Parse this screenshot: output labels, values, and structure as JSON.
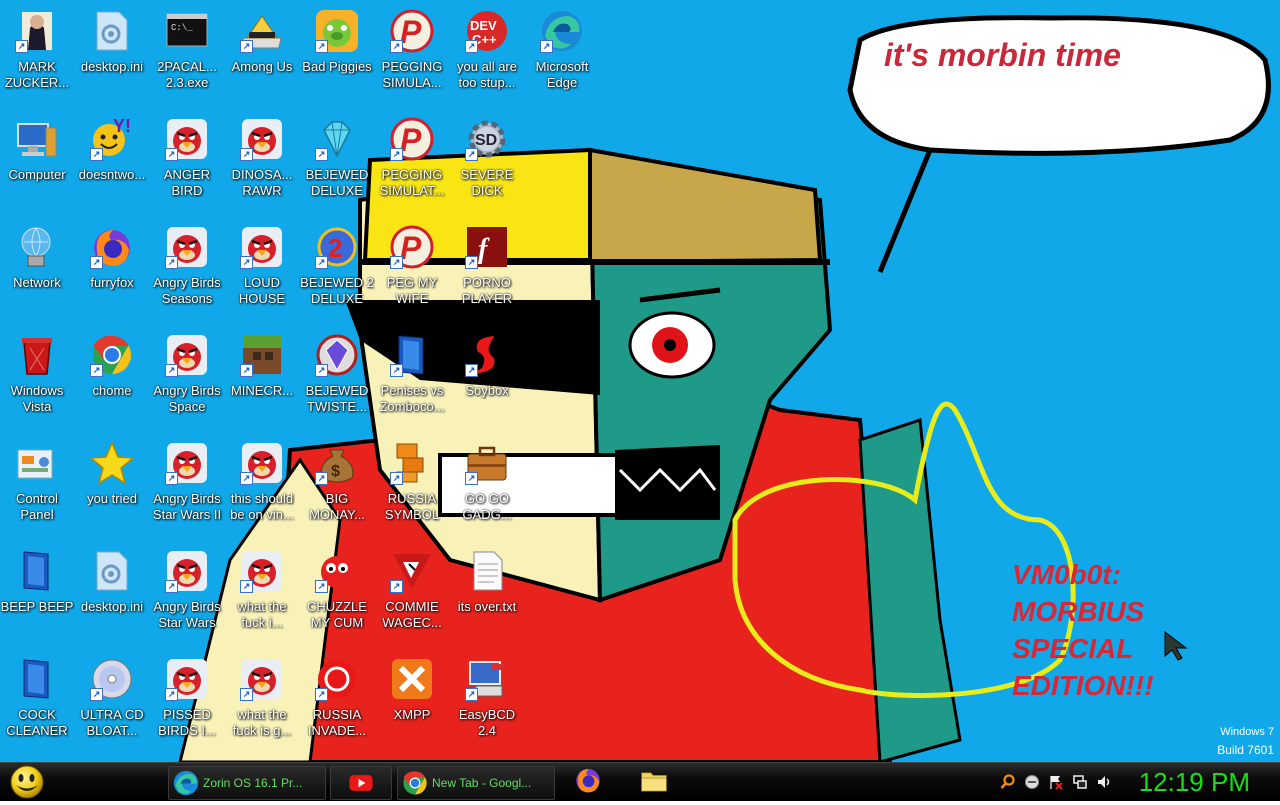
{
  "wallpaper": {
    "speech_bubble_text": "it's morbin time",
    "tag_line_1": "VM0b0t:",
    "tag_line_2": "MORBIUS",
    "tag_line_3": "SPECIAL",
    "tag_line_4": "EDITION!!!",
    "background_color": "#10a8e8"
  },
  "desktop_icons": [
    {
      "label": "MARK ZUCKER...",
      "icon": "person-icon",
      "shortcut": true
    },
    {
      "label": "desktop.ini",
      "icon": "settings-file-icon",
      "shortcut": false
    },
    {
      "label": "2PACAL... 2.3.exe",
      "icon": "console-icon",
      "shortcut": false
    },
    {
      "label": "Among Us",
      "icon": "scanner-icon",
      "shortcut": true
    },
    {
      "label": "Bad Piggies",
      "icon": "green-pig-icon",
      "shortcut": true
    },
    {
      "label": "PEGGING SIMULA...",
      "icon": "p-logo-icon",
      "shortcut": true
    },
    {
      "label": "you all are too stup...",
      "icon": "devcpp-icon",
      "shortcut": true
    },
    {
      "label": "Microsoft Edge",
      "icon": "edge-icon",
      "shortcut": true
    },
    {
      "label": "Computer",
      "icon": "computer-icon",
      "shortcut": false
    },
    {
      "label": "doesntwo...",
      "icon": "yahoo-icon",
      "shortcut": true
    },
    {
      "label": "ANGER BIRD",
      "icon": "angry-bird-icon",
      "shortcut": true
    },
    {
      "label": "DINOSA... RAWR",
      "icon": "angry-bird-icon",
      "shortcut": true
    },
    {
      "label": "BEJEWED DELUXE",
      "icon": "diamond-icon",
      "shortcut": true
    },
    {
      "label": "PEGGING SIMULAT...",
      "icon": "p-logo-icon",
      "shortcut": true
    },
    {
      "label": "SEVERE DICK",
      "icon": "gear-sd-icon",
      "shortcut": true
    },
    {
      "label": "Network",
      "icon": "network-globe-icon",
      "shortcut": false
    },
    {
      "label": "furryfox",
      "icon": "firefox-icon",
      "shortcut": true
    },
    {
      "label": "Angry Birds Seasons",
      "icon": "angry-bird-icon",
      "shortcut": true
    },
    {
      "label": "LOUD HOUSE",
      "icon": "angry-bird-icon",
      "shortcut": true
    },
    {
      "label": "BEJEWED 2 DELUXE",
      "icon": "bejeweled2-icon",
      "shortcut": true
    },
    {
      "label": "PEG MY WIFE",
      "icon": "p-logo-icon",
      "shortcut": true
    },
    {
      "label": "PORNO PLAYER",
      "icon": "flash-icon",
      "shortcut": true
    },
    {
      "label": "Windows Vista",
      "icon": "recycle-bin-icon",
      "shortcut": false
    },
    {
      "label": "chome",
      "icon": "chrome-icon",
      "shortcut": true
    },
    {
      "label": "Angry Birds Space",
      "icon": "angry-bird-icon",
      "shortcut": true
    },
    {
      "label": "MINECR...",
      "icon": "minecraft-icon",
      "shortcut": true
    },
    {
      "label": "BEJEWED TWISTE...",
      "icon": "gem-icon",
      "shortcut": true
    },
    {
      "label": "Penises vs Zomboco...",
      "icon": "blue-box-icon",
      "shortcut": true
    },
    {
      "label": "Soybox",
      "icon": "soybox-icon",
      "shortcut": true
    },
    {
      "label": "Control Panel",
      "icon": "control-panel-icon",
      "shortcut": false
    },
    {
      "label": "you tried",
      "icon": "star-icon",
      "shortcut": false
    },
    {
      "label": "Angry Birds Star Wars II",
      "icon": "angry-bird-icon",
      "shortcut": true
    },
    {
      "label": "this should be on vin...",
      "icon": "angry-bird-icon",
      "shortcut": true
    },
    {
      "label": "BIG MONAY...",
      "icon": "money-bag-icon",
      "shortcut": true
    },
    {
      "label": "RUSSIA SYMBOL",
      "icon": "orange-blocks-icon",
      "shortcut": true
    },
    {
      "label": "GO GO GADG...",
      "icon": "briefcase-icon",
      "shortcut": true
    },
    {
      "label": "BEEP BEEP",
      "icon": "blue-box-icon",
      "shortcut": false
    },
    {
      "label": "desktop.ini",
      "icon": "settings-file-icon",
      "shortcut": false
    },
    {
      "label": "Angry Birds Star Wars",
      "icon": "angry-bird-icon",
      "shortcut": true
    },
    {
      "label": "what the fuck i...",
      "icon": "angry-bird-icon",
      "shortcut": true
    },
    {
      "label": "CHUZZLE MY CUM",
      "icon": "chuzzle-icon",
      "shortcut": true
    },
    {
      "label": "COMMIE WAGEC...",
      "icon": "commie-icon",
      "shortcut": true
    },
    {
      "label": "its over.txt",
      "icon": "text-file-icon",
      "shortcut": false
    },
    {
      "label": "COCK CLEANER",
      "icon": "blue-box-icon",
      "shortcut": false
    },
    {
      "label": "ULTRA CD BLOAT...",
      "icon": "cd-icon",
      "shortcut": true
    },
    {
      "label": "PISSED BIRDS I...",
      "icon": "angry-bird-icon",
      "shortcut": true
    },
    {
      "label": "what the fuck is g...",
      "icon": "angry-bird-icon",
      "shortcut": true
    },
    {
      "label": "RUSSIA INVADE...",
      "icon": "red-ring-icon",
      "shortcut": true
    },
    {
      "label": "XMPP",
      "icon": "xampp-icon",
      "shortcut": false
    },
    {
      "label": "EasyBCD 2.4",
      "icon": "easybcd-icon",
      "shortcut": true
    }
  ],
  "watermark": {
    "line1": "Windows 7",
    "line2": "Build 7601"
  },
  "taskbar": {
    "buttons": [
      {
        "label": "Zorin OS 16.1 Pr...",
        "icon": "edge-icon"
      },
      {
        "label": "",
        "icon": "youtube-icon"
      },
      {
        "label": "New Tab - Googl...",
        "icon": "chrome-icon"
      }
    ],
    "pinned": [
      {
        "icon": "firefox-icon"
      },
      {
        "icon": "folder-icon"
      }
    ],
    "clock": "12:19 PM"
  }
}
